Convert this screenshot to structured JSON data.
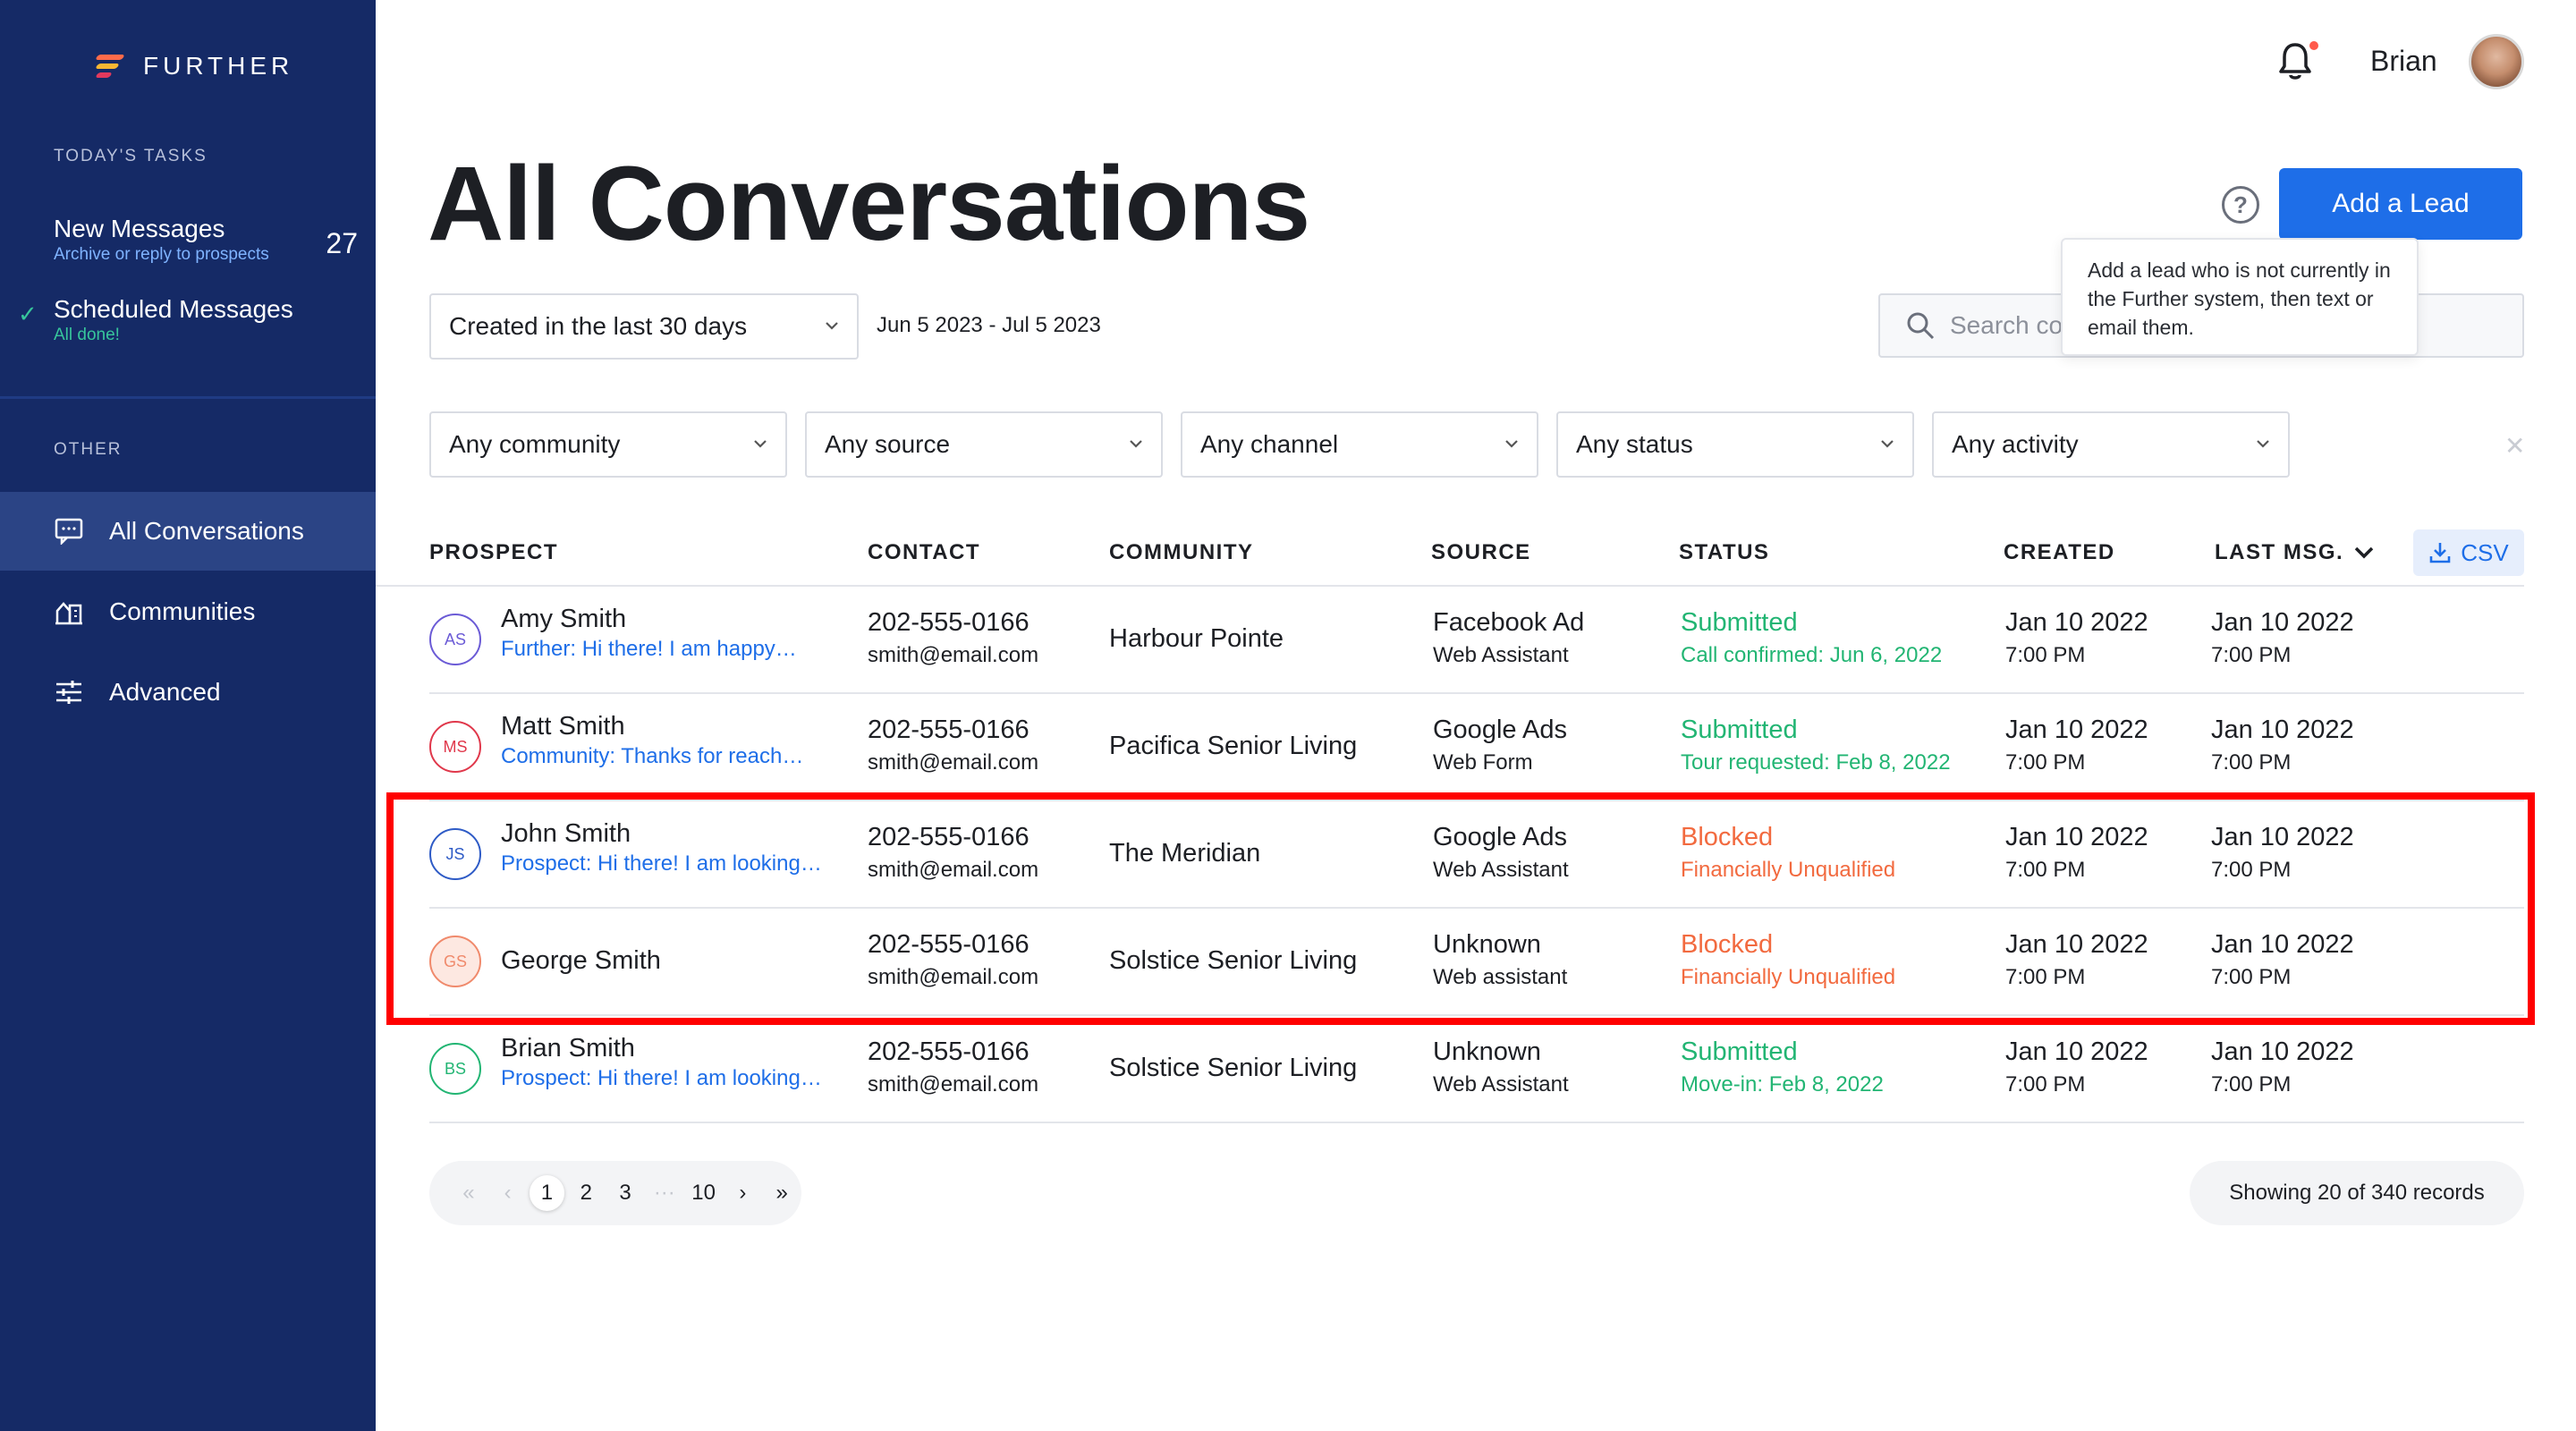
{
  "brand": {
    "name": "FURTHER"
  },
  "sidebar": {
    "tasks_label": "TODAY'S TASKS",
    "tasks": [
      {
        "title": "New Messages",
        "subtitle": "Archive or reply to prospects",
        "count": "27"
      },
      {
        "title": "Scheduled Messages",
        "subtitle": "All done!",
        "done": true
      }
    ],
    "other_label": "OTHER",
    "nav": [
      {
        "label": "All Conversations",
        "icon": "chat-icon",
        "active": true
      },
      {
        "label": "Communities",
        "icon": "building-icon"
      },
      {
        "label": "Advanced",
        "icon": "sliders-icon"
      }
    ]
  },
  "header": {
    "user_name": "Brian",
    "notification_icon": "bell-icon"
  },
  "page": {
    "title": "All Conversations",
    "add_lead_label": "Add a Lead",
    "help_glyph": "?",
    "tooltip": "Add a lead who is not currently in the Further system, then text or email them.",
    "date_filter": "Created in the last 30 days",
    "date_range": "Jun 5 2023 - Jul 5 2023",
    "search_placeholder": "Search co"
  },
  "filters": [
    "Any community",
    "Any source",
    "Any channel",
    "Any status",
    "Any activity"
  ],
  "table": {
    "columns": [
      "PROSPECT",
      "CONTACT",
      "COMMUNITY",
      "SOURCE",
      "STATUS",
      "CREATED",
      "LAST MSG."
    ],
    "csv_label": "CSV",
    "rows": [
      {
        "initials": "AS",
        "badge_color": "#6b5bd6",
        "name": "Amy Smith",
        "message": "Further: Hi there! I am happy…",
        "phone": "202-555-0166",
        "email": "smith@email.com",
        "community": "Harbour Pointe",
        "source": "Facebook Ad",
        "source_sub": "Web Assistant",
        "status": "Submitted",
        "status_sub": "Call confirmed: Jun 6, 2022",
        "status_color": "#22b573",
        "created_date": "Jan 10 2022",
        "created_time": "7:00 PM",
        "last_date": "Jan 10 2022",
        "last_time": "7:00 PM"
      },
      {
        "initials": "MS",
        "badge_color": "#e0384b",
        "name": "Matt Smith",
        "message": "Community: Thanks for reach…",
        "phone": "202-555-0166",
        "email": "smith@email.com",
        "community": "Pacifica Senior Living",
        "source": "Google Ads",
        "source_sub": "Web Form",
        "status": "Submitted",
        "status_sub": "Tour requested: Feb 8, 2022",
        "status_color": "#22b573",
        "created_date": "Jan 10 2022",
        "created_time": "7:00 PM",
        "last_date": "Jan 10 2022",
        "last_time": "7:00 PM"
      },
      {
        "initials": "JS",
        "badge_color": "#2e5bc6",
        "name": "John Smith",
        "message": "Prospect: Hi there! I am looking…",
        "phone": "202-555-0166",
        "email": "smith@email.com",
        "community": "The Meridian",
        "source": "Google Ads",
        "source_sub": "Web Assistant",
        "status": "Blocked",
        "status_sub": "Financially Unqualified",
        "status_color": "#f26a3f",
        "created_date": "Jan 10 2022",
        "created_time": "7:00 PM",
        "last_date": "Jan 10 2022",
        "last_time": "7:00 PM"
      },
      {
        "initials": "GS",
        "badge_color": "#f08a6c",
        "badge_fill": "#fde8e1",
        "name": "George Smith",
        "message": "",
        "phone": "202-555-0166",
        "email": "smith@email.com",
        "community": "Solstice Senior Living",
        "source": "Unknown",
        "source_sub": "Web assistant",
        "status": "Blocked",
        "status_sub": "Financially Unqualified",
        "status_color": "#f26a3f",
        "created_date": "Jan 10 2022",
        "created_time": "7:00 PM",
        "last_date": "Jan 10 2022",
        "last_time": "7:00 PM"
      },
      {
        "initials": "BS",
        "badge_color": "#22b573",
        "name": "Brian Smith",
        "message": "Prospect: Hi there! I am looking…",
        "phone": "202-555-0166",
        "email": "smith@email.com",
        "community": "Solstice Senior Living",
        "source": "Unknown",
        "source_sub": "Web Assistant",
        "status": "Submitted",
        "status_sub": "Move-in: Feb 8, 2022",
        "status_color": "#22b573",
        "created_date": "Jan 10 2022",
        "created_time": "7:00 PM",
        "last_date": "Jan 10 2022",
        "last_time": "7:00 PM"
      }
    ]
  },
  "pagination": {
    "first": "«",
    "prev": "‹",
    "pages": [
      "1",
      "2",
      "3"
    ],
    "ellipsis": "···",
    "last_page": "10",
    "next": "›",
    "last": "»",
    "current": "1",
    "records": "Showing 20 of 340 records"
  },
  "colors": {
    "sidebar": "#152a66",
    "accent": "#1e6ee8",
    "success": "#22b573",
    "blocked": "#f26a3f",
    "highlight": "#ff0000"
  }
}
